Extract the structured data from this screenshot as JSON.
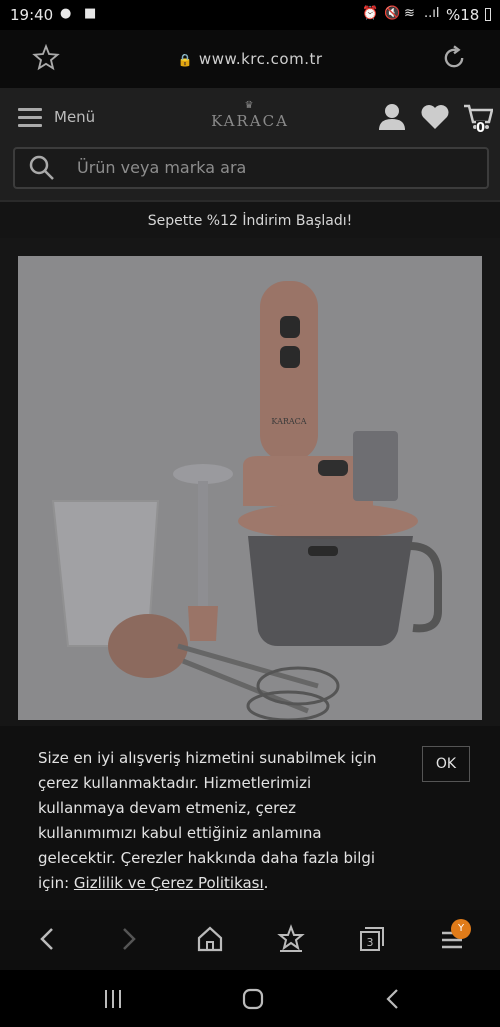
{
  "status": {
    "time": "19:40",
    "battery": "%18",
    "signal_text": "..ıl"
  },
  "browser": {
    "url": "www.krc.com.tr"
  },
  "header": {
    "menu_label": "Menü",
    "logo_text": "KARACA",
    "cart_count": "0"
  },
  "search": {
    "placeholder": "Ürün veya marka ara"
  },
  "banner": {
    "text": "Sepette %12 İndirim Başladı!"
  },
  "product": {
    "brand_mark": "KARACA"
  },
  "cookie": {
    "text": "Size en iyi alışveriş hizmetini sunabilmek için çerez kullanmaktadır. Hizmetlerimizi kullanmaya devam etmeniz, çerez kullanımımızı kabul ettiğiniz anlamına gelecektir. Çerezler hakkında daha fazla bilgi için: ",
    "link": "Gizlilik ve Çerez Politikası",
    "suffix": ".",
    "ok_label": "OK"
  },
  "bottom_nav": {
    "tabs_count": "3",
    "profile_badge": "Y"
  },
  "colors": {
    "accent": "#e07b19",
    "product_tint": "#c9a08f"
  }
}
